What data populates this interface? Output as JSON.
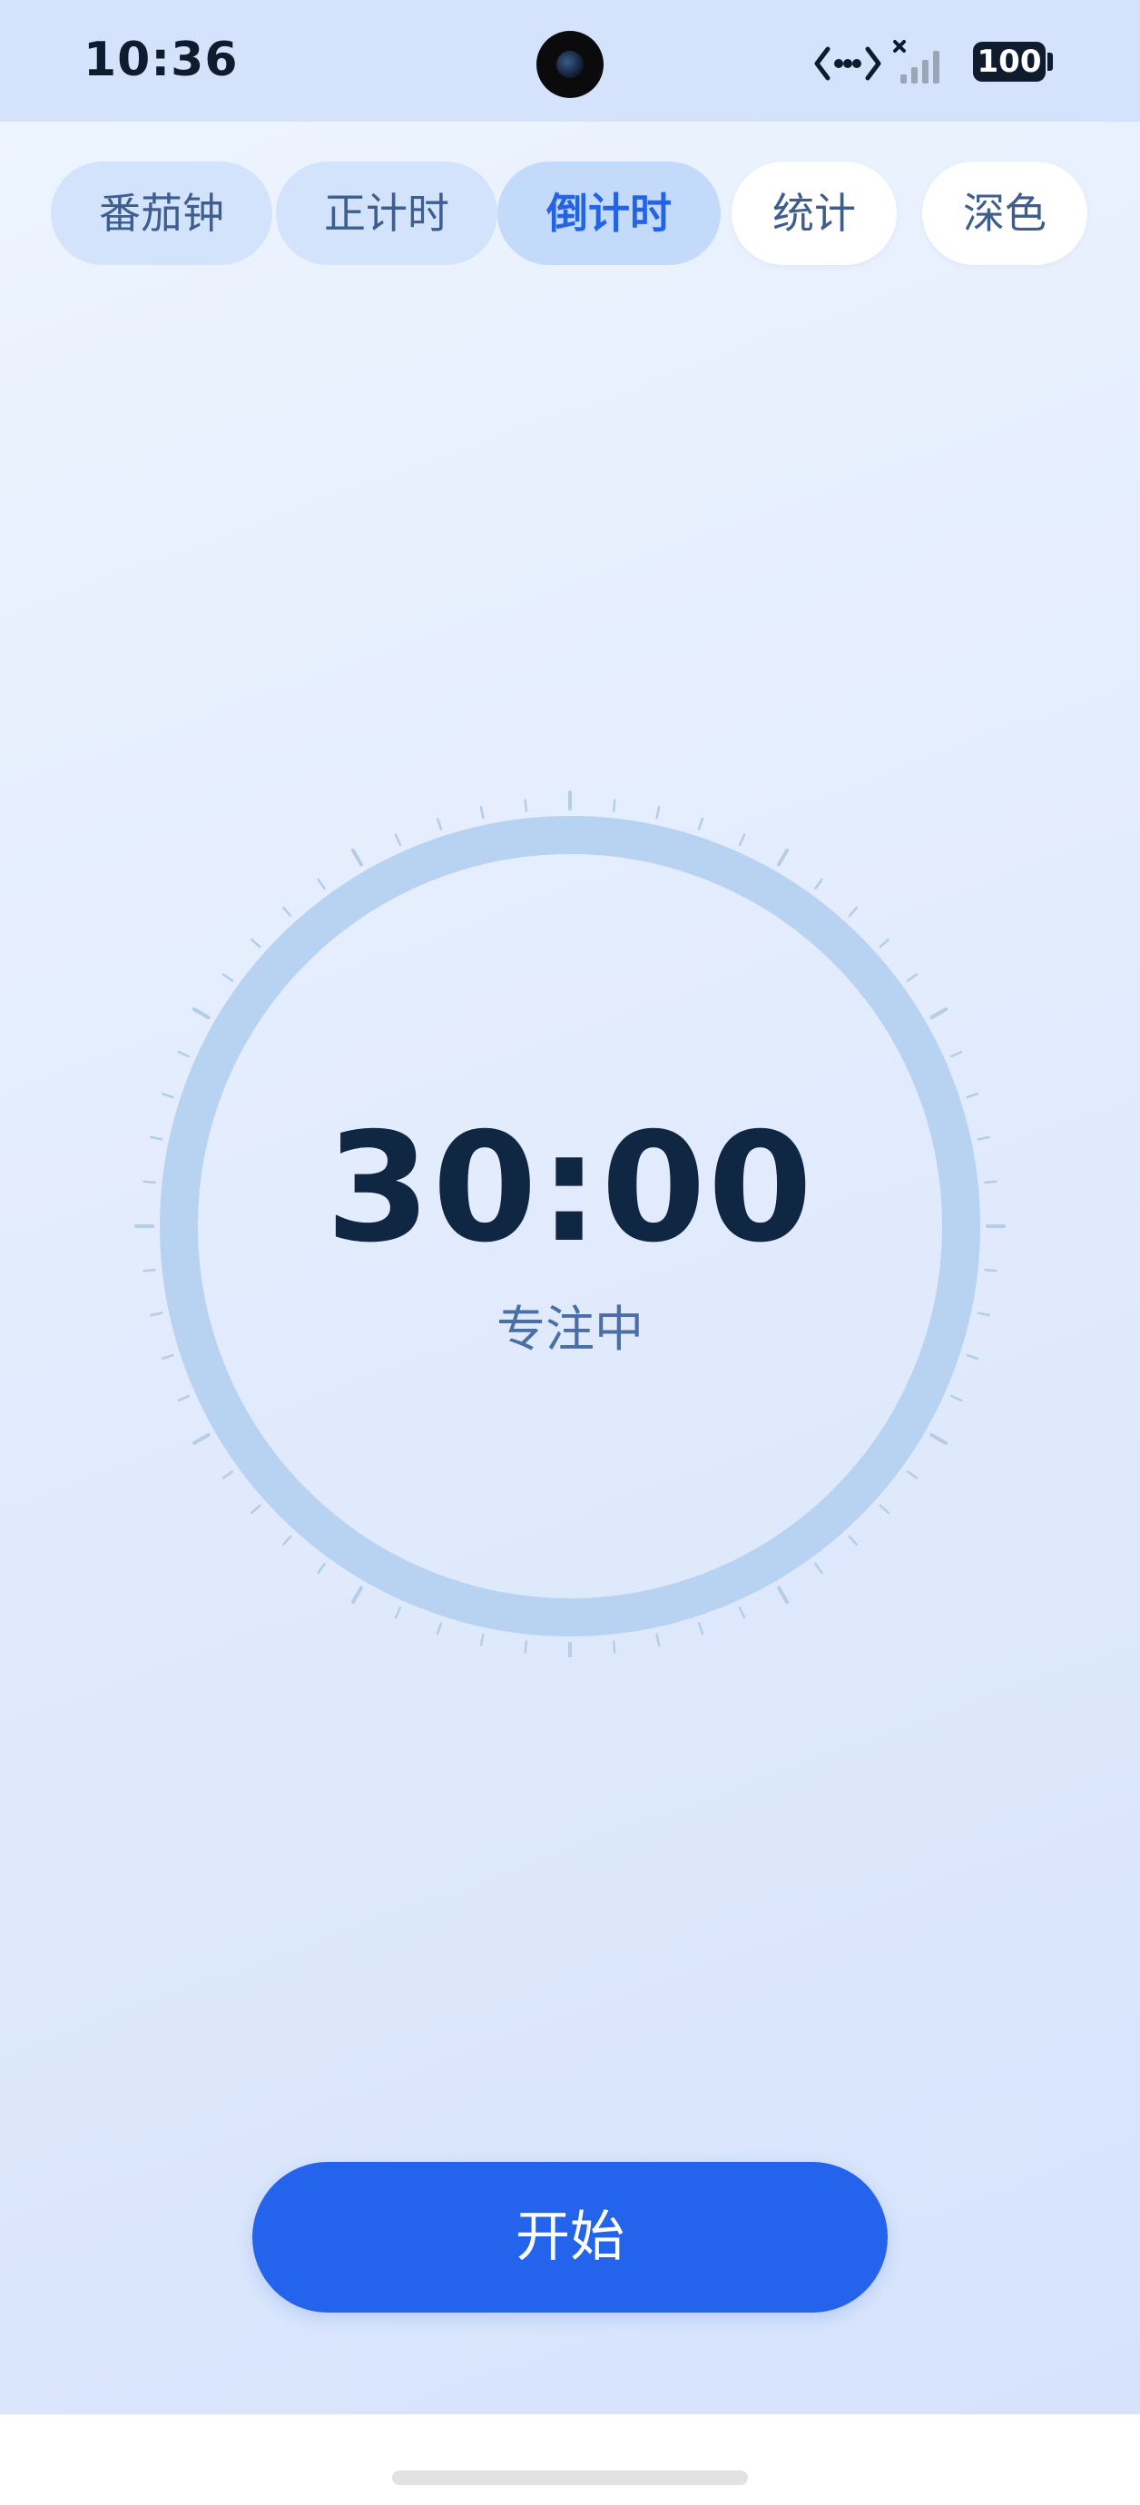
{
  "status_bar": {
    "time": "10:36",
    "battery": "100",
    "icons": [
      "data-transfer-icon",
      "signal-icon",
      "battery-icon"
    ]
  },
  "tabs": [
    {
      "label": "番茄钟",
      "selected": false
    },
    {
      "label": "正计时",
      "selected": false
    },
    {
      "label": "倒计时",
      "selected": true
    },
    {
      "label": "统计",
      "selected": false
    },
    {
      "label": "深色",
      "selected": false
    }
  ],
  "timer": {
    "display": "30:00",
    "state": "专注中",
    "progress": 1.0
  },
  "start_button": {
    "label": "开始"
  },
  "colors": {
    "accent": "#2463eb",
    "ring": "#b7d3f1",
    "tick": "#b4cde8",
    "text_dark": "#0f2742",
    "text_muted": "#4a6fa6"
  }
}
